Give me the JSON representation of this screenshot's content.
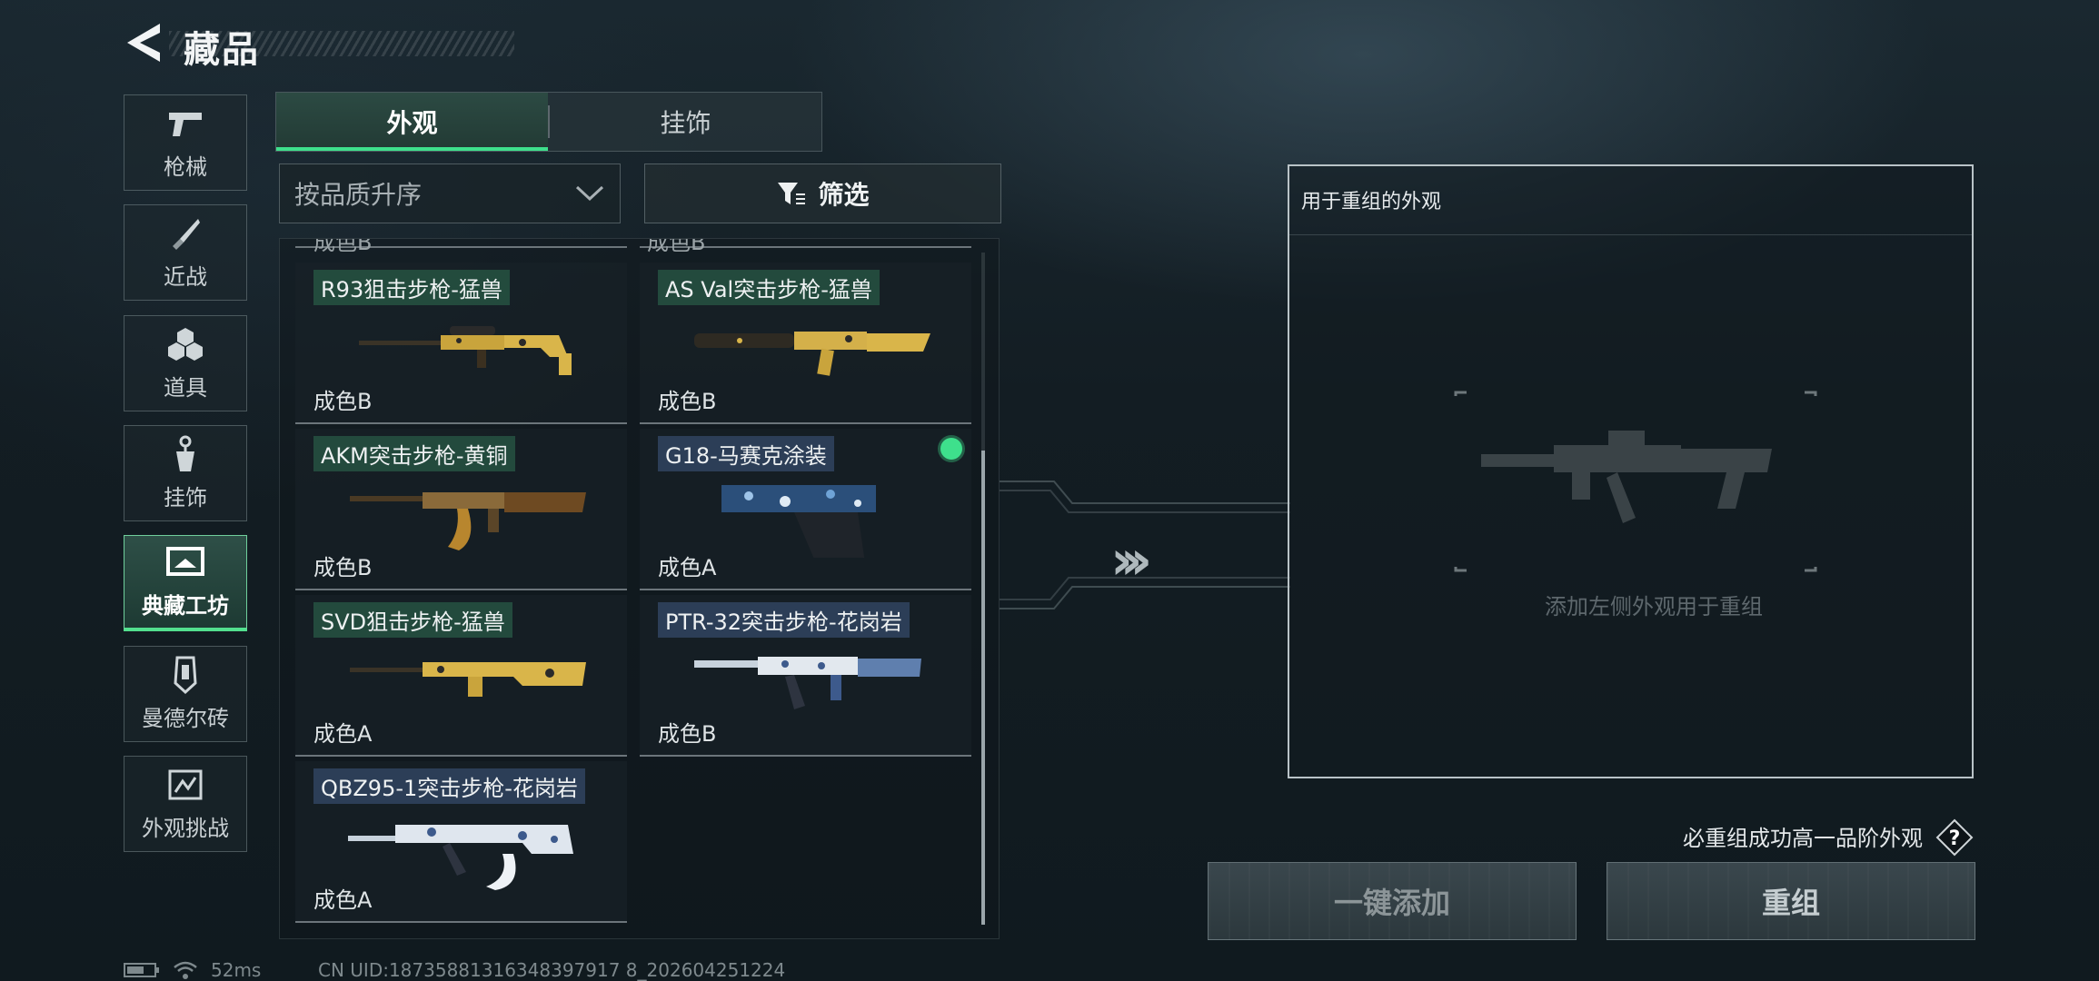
{
  "header": {
    "title": "藏品"
  },
  "nav": [
    {
      "label": "枪械",
      "icon": "pistol-icon"
    },
    {
      "label": "近战",
      "icon": "knife-icon"
    },
    {
      "label": "道具",
      "icon": "grenades-icon"
    },
    {
      "label": "挂饰",
      "icon": "charm-icon"
    },
    {
      "label": "典藏工坊",
      "icon": "workshop-icon",
      "active": true
    },
    {
      "label": "曼德尔砖",
      "icon": "brick-icon"
    },
    {
      "label": "外观挑战",
      "icon": "challenge-icon"
    }
  ],
  "tabs": [
    {
      "label": "外观",
      "active": true
    },
    {
      "label": "挂饰",
      "active": false
    }
  ],
  "sort": {
    "value": "按品质升序"
  },
  "filter": {
    "label": "筛选"
  },
  "top_partial": [
    "成色B",
    "成色B"
  ],
  "items": [
    {
      "name": "R93狙击步枪-猛兽",
      "grade": "成色B",
      "skin": "gold"
    },
    {
      "name": "AS Val突击步枪-猛兽",
      "grade": "成色B",
      "skin": "gold"
    },
    {
      "name": "AKM突击步枪-黄铜",
      "grade": "成色B",
      "skin": "brass"
    },
    {
      "name": "G18-马赛克涂装",
      "grade": "成色A",
      "skin": "mosaic",
      "selected": true
    },
    {
      "name": "SVD狙击步枪-猛兽",
      "grade": "成色A",
      "skin": "gold"
    },
    {
      "name": "PTR-32突击步枪-花岗岩",
      "grade": "成色B",
      "skin": "granite"
    },
    {
      "name": "QBZ95-1突击步枪-花岗岩",
      "grade": "成色A",
      "skin": "granite"
    }
  ],
  "reorg": {
    "title": "用于重组的外观",
    "placeholder": "添加左侧外观用于重组",
    "guarantee": "必重组成功高一品阶外观"
  },
  "buttons": {
    "add_all": "一键添加",
    "reorg": "重组"
  },
  "status": {
    "ping": "52ms",
    "uid": "CN UID:18735881316348397917 8_202604251224"
  },
  "colors": {
    "accent": "#3ee08c",
    "gold": "#d9b54a",
    "granite": "#6f8fb8"
  }
}
